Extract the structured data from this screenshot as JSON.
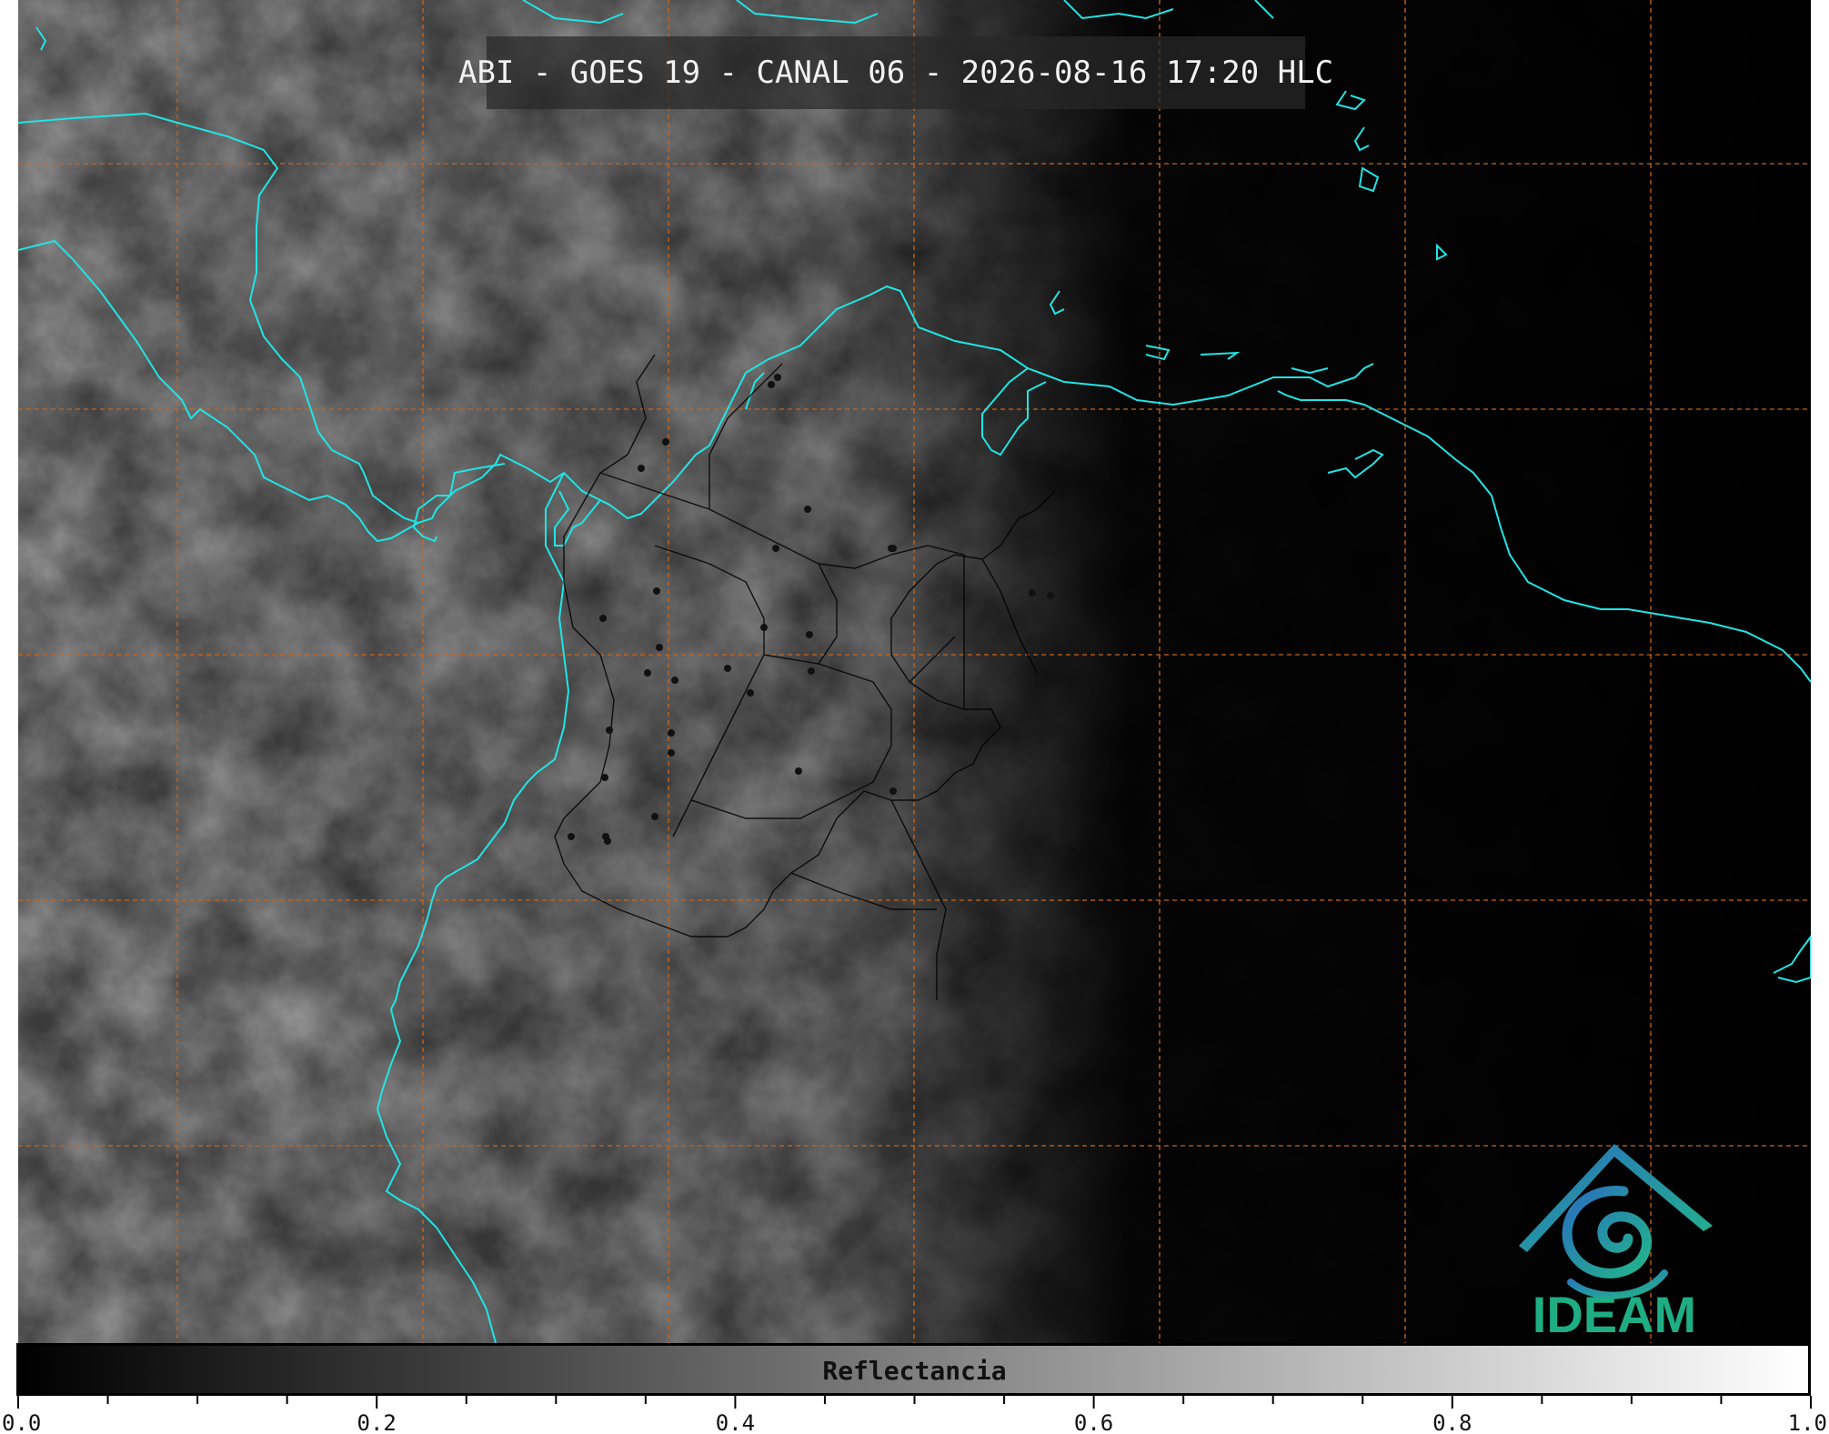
{
  "title": "ABI - GOES 19 - CANAL 06 - 2026-08-16 17:20 HLC",
  "colorbar": {
    "label": "Reflectancia",
    "range": [
      0.0,
      1.0
    ],
    "major_ticks": [
      "0.0",
      "0.2",
      "0.4",
      "0.6",
      "0.8",
      "1.0"
    ],
    "minor_step": 0.05,
    "colormap": "grayscale black-to-white"
  },
  "logo": {
    "text": "IDEAM",
    "color": "#1fad84"
  },
  "colors": {
    "coastline": "#22e4e4",
    "grid": "#c8661e",
    "borders": "#000000",
    "background": "#000000"
  },
  "map": {
    "grid": "dashed orange lat/lon graticule",
    "features": [
      "coastlines",
      "country borders",
      "department borders",
      "city dots"
    ]
  }
}
